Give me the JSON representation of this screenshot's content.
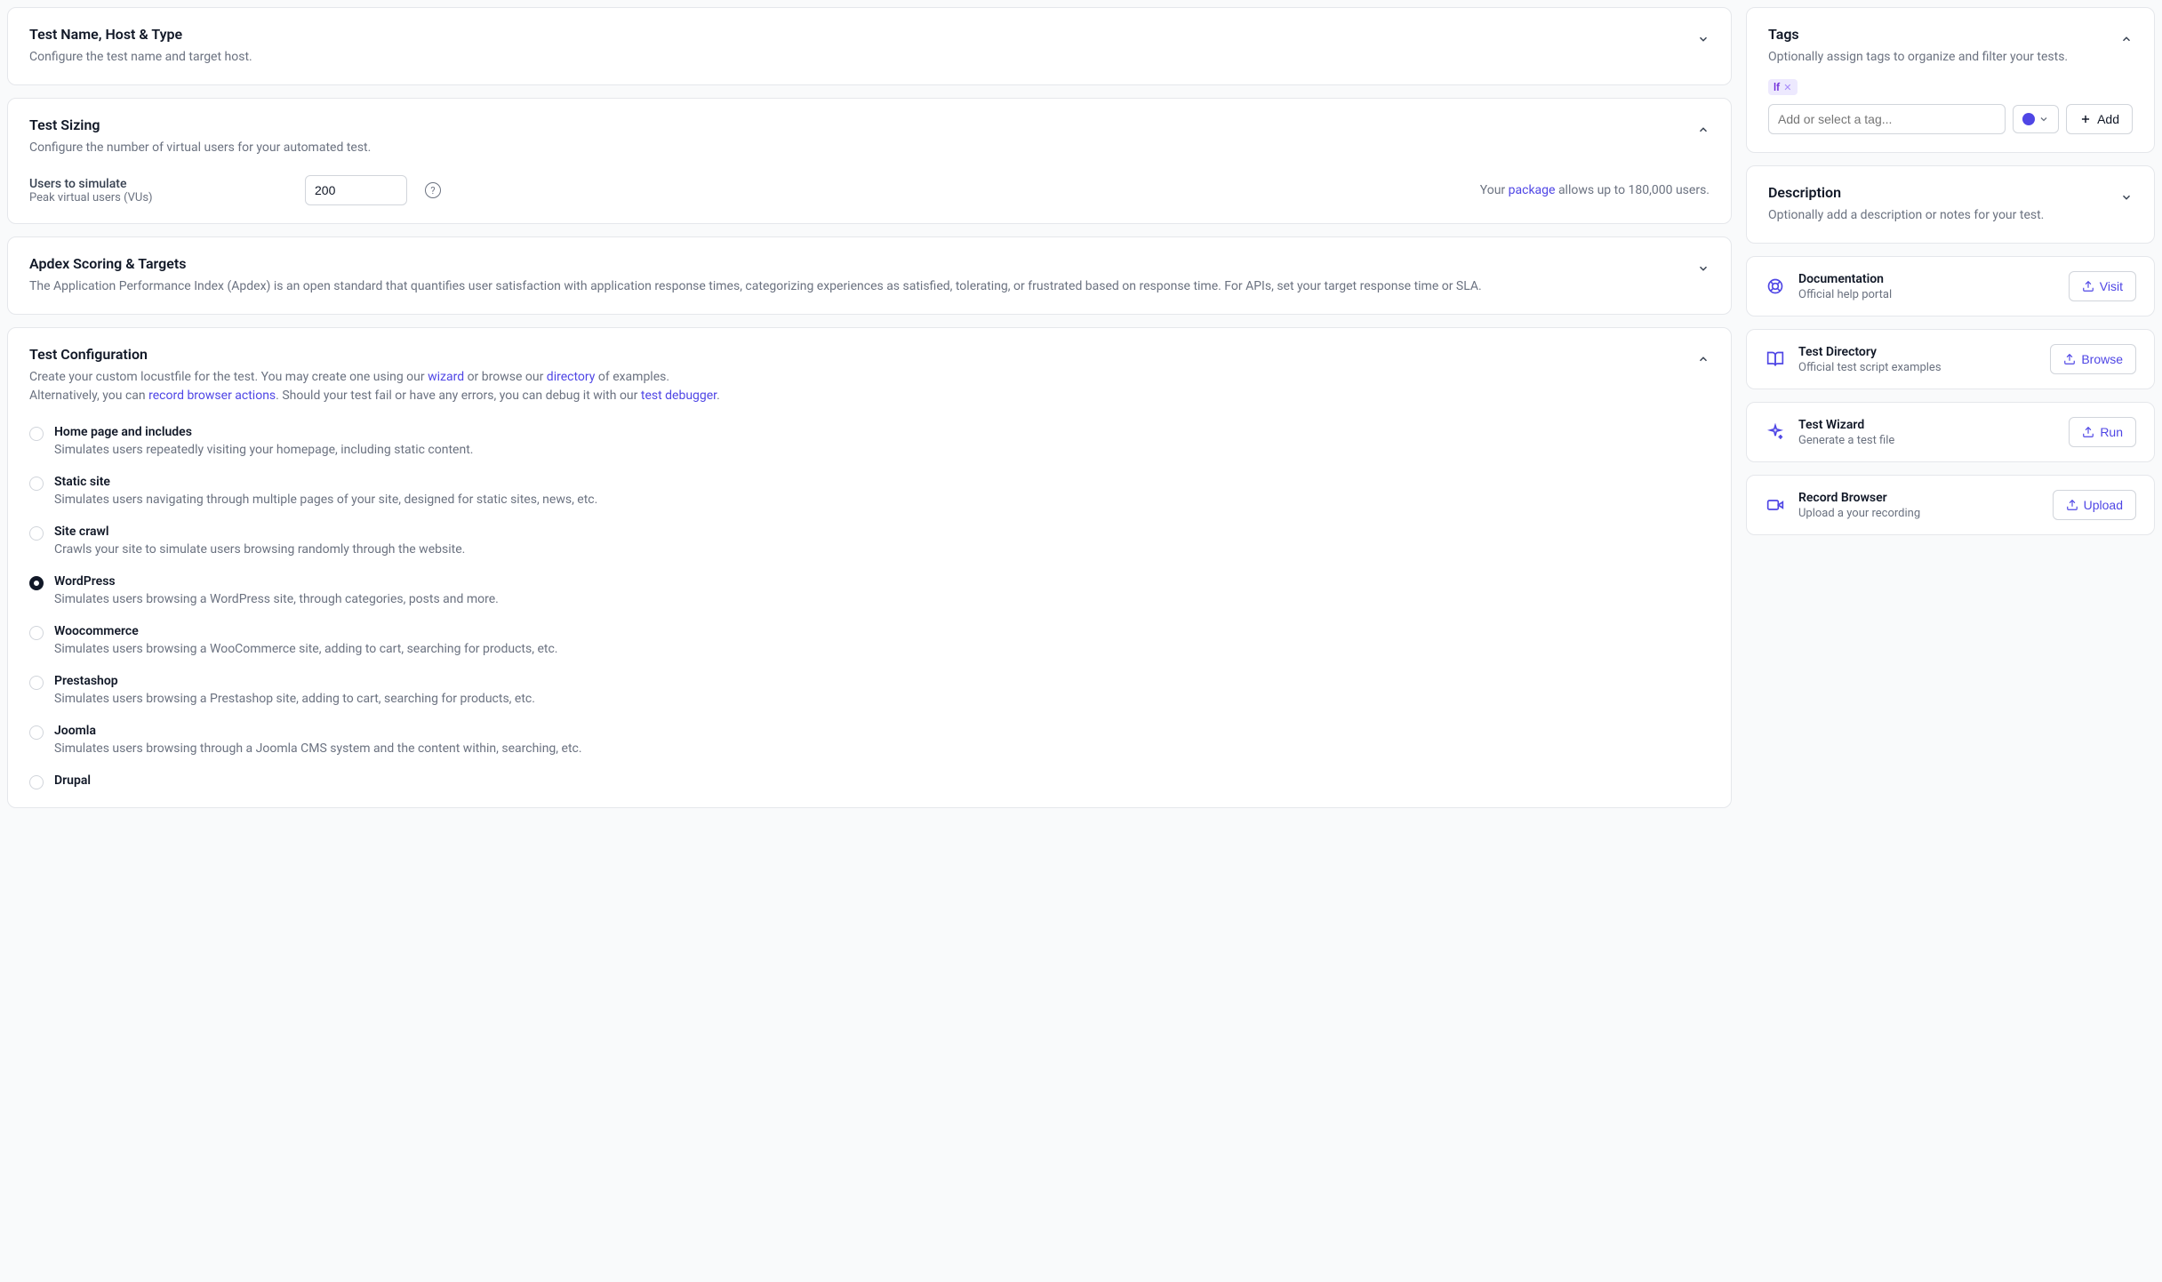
{
  "sections": {
    "name": {
      "title": "Test Name, Host & Type",
      "subtitle": "Configure the test name and target host."
    },
    "sizing": {
      "title": "Test Sizing",
      "subtitle": "Configure the number of virtual users for your automated test.",
      "users_label": "Users to simulate",
      "users_help": "Peak virtual users (VUs)",
      "users_value": "200",
      "allowance_prefix": "Your ",
      "allowance_link": "package",
      "allowance_suffix": " allows up to 180,000 users."
    },
    "apdex": {
      "title": "Apdex Scoring & Targets",
      "subtitle": "The Application Performance Index (Apdex) is an open standard that quantifies user satisfaction with application response times, categorizing experiences as satisfied, tolerating, or frustrated based on response time. For APIs, set your target response time or SLA."
    },
    "config": {
      "title": "Test Configuration",
      "sub1": "Create your custom locustfile for the test. You may create one using our ",
      "wizard_link": "wizard",
      "sub2": " or browse our ",
      "directory_link": "directory",
      "sub3": " of examples.",
      "sub4": "Alternatively, you can ",
      "record_link": "record browser actions",
      "sub5": ". Should your test fail or have any errors, you can debug it with our ",
      "debugger_link": "test debugger",
      "sub6": ".",
      "options": [
        {
          "label": "Home page and includes",
          "desc": "Simulates users repeatedly visiting your homepage, including static content.",
          "selected": false
        },
        {
          "label": "Static site",
          "desc": "Simulates users navigating through multiple pages of your site, designed for static sites, news, etc.",
          "selected": false
        },
        {
          "label": "Site crawl",
          "desc": "Crawls your site to simulate users browsing randomly through the website.",
          "selected": false
        },
        {
          "label": "WordPress",
          "desc": "Simulates users browsing a WordPress site, through categories, posts and more.",
          "selected": true
        },
        {
          "label": "Woocommerce",
          "desc": "Simulates users browsing a WooCommerce site, adding to cart, searching for products, etc.",
          "selected": false
        },
        {
          "label": "Prestashop",
          "desc": "Simulates users browsing a Prestashop site, adding to cart, searching for products, etc.",
          "selected": false
        },
        {
          "label": "Joomla",
          "desc": "Simulates users browsing through a Joomla CMS system and the content within, searching, etc.",
          "selected": false
        },
        {
          "label": "Drupal",
          "desc": "",
          "selected": false
        }
      ]
    }
  },
  "sidebar": {
    "tags": {
      "title": "Tags",
      "subtitle": "Optionally assign tags to organize and filter your tests.",
      "chips": [
        "lf"
      ],
      "placeholder": "Add or select a tag...",
      "add_label": "Add"
    },
    "description": {
      "title": "Description",
      "subtitle": "Optionally add a description or notes for your test."
    },
    "resources": [
      {
        "icon": "lifebuoy",
        "title": "Documentation",
        "desc": "Official help portal",
        "action": "Visit",
        "accent": true
      },
      {
        "icon": "book",
        "title": "Test Directory",
        "desc": "Official test script examples",
        "action": "Browse",
        "accent": false
      },
      {
        "icon": "sparkle",
        "title": "Test Wizard",
        "desc": "Generate a test file",
        "action": "Run",
        "accent": false
      },
      {
        "icon": "video",
        "title": "Record Browser",
        "desc": "Upload a your recording",
        "action": "Upload",
        "accent": false
      }
    ]
  }
}
